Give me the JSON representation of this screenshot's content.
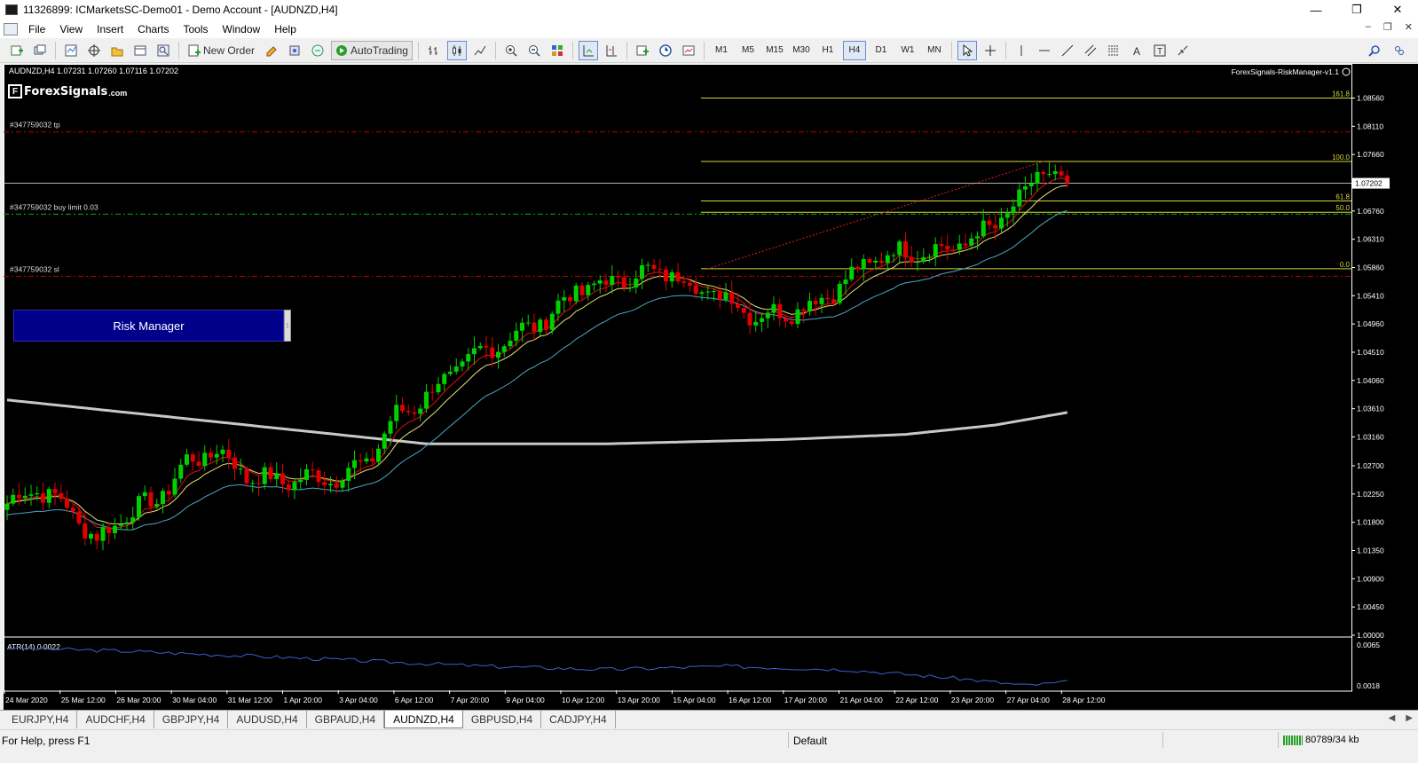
{
  "window": {
    "title": "11326899: ICMarketsSC-Demo01 - Demo Account - [AUDNZD,H4]",
    "minimize": "—",
    "restore": "❐",
    "close": "✕"
  },
  "menu": {
    "items": [
      "File",
      "View",
      "Insert",
      "Charts",
      "Tools",
      "Window",
      "Help"
    ],
    "mdi_minimize": "–",
    "mdi_restore": "❐",
    "mdi_close": "✕"
  },
  "toolbar": {
    "new_order": "New Order",
    "auto_trading": "AutoTrading",
    "timeframes": [
      "M1",
      "M5",
      "M15",
      "M30",
      "H1",
      "H4",
      "D1",
      "W1",
      "MN"
    ],
    "active_timeframe": "H4"
  },
  "chart": {
    "symbol_info": "AUDNZD,H4  1.07231 1.07260 1.07116 1.07202",
    "indicator_name": "ForexSignals-RiskManager-v1.1",
    "logo_text": "ForexSignals",
    "logo_suffix": ".com",
    "logo_mark": "F",
    "risk_manager_button": "Risk Manager",
    "risk_manager_grip": "⁞",
    "current_price_label": "1.07202",
    "order_labels": {
      "tp": "#347759032 tp",
      "buy_limit": "#347759032 buy limit 0.03",
      "sl": "#347759032 sl"
    },
    "fib_labels": [
      "161.8",
      "100.0",
      "61.8",
      "50.0",
      "0.0"
    ],
    "atr_label": "ATR(14) 0.0022",
    "atr_scale": [
      "0.0065",
      "0.0018"
    ],
    "colors": {
      "background": "#000000",
      "bull": "#00d000",
      "bear": "#e00000",
      "fib": "#d8d840",
      "tp_sl": "#c00000",
      "buy_limit": "#00b000",
      "ma_fast": "#e01010",
      "ma_mid": "#e8e070",
      "ma_slow": "#4aa8c8",
      "ma_long": "#c8c8c8",
      "atr": "#3a5fd0"
    }
  },
  "chart_data": {
    "type": "candlestick",
    "symbol": "AUDNZD",
    "timeframe": "H4",
    "ylim": [
      1.0,
      1.0885
    ],
    "price_ticks": [
      "1.08560",
      "1.08110",
      "1.07660",
      "1.07202",
      "1.06760",
      "1.06310",
      "1.05860",
      "1.05410",
      "1.04960",
      "1.04510",
      "1.04060",
      "1.03610",
      "1.03160",
      "1.02700",
      "1.02250",
      "1.01800",
      "1.01350",
      "1.00900",
      "1.00450",
      "1.00000"
    ],
    "time_labels": [
      "24 Mar 2020",
      "25 Mar 12:00",
      "26 Mar 20:00",
      "30 Mar 04:00",
      "31 Mar 12:00",
      "1 Apr 20:00",
      "3 Apr 04:00",
      "6 Apr 12:00",
      "7 Apr 20:00",
      "9 Apr 04:00",
      "10 Apr 12:00",
      "13 Apr 20:00",
      "15 Apr 04:00",
      "16 Apr 12:00",
      "17 Apr 20:00",
      "21 Apr 04:00",
      "22 Apr 12:00",
      "23 Apr 20:00",
      "27 Apr 04:00",
      "28 Apr 12:00"
    ],
    "current_price": 1.07202,
    "levels": {
      "tp": 1.0802,
      "buy_limit": 1.0671,
      "sl": 1.0572,
      "fib_161_8": 1.0856,
      "fib_100": 1.0755,
      "fib_61_8": 1.0692,
      "fib_50": 1.0674,
      "fib_0": 1.0584
    },
    "close_anchors": [
      [
        0,
        1.021
      ],
      [
        5,
        1.0235
      ],
      [
        10,
        1.0205
      ],
      [
        15,
        1.015
      ],
      [
        20,
        1.0195
      ],
      [
        25,
        1.0215
      ],
      [
        30,
        1.0275
      ],
      [
        35,
        1.0295
      ],
      [
        40,
        1.0255
      ],
      [
        45,
        1.0245
      ],
      [
        50,
        1.025
      ],
      [
        55,
        1.0252
      ],
      [
        60,
        1.0275
      ],
      [
        65,
        1.035
      ],
      [
        70,
        1.038
      ],
      [
        75,
        1.0425
      ],
      [
        80,
        1.0455
      ],
      [
        85,
        1.048
      ],
      [
        90,
        1.0505
      ],
      [
        95,
        1.055
      ],
      [
        100,
        1.056
      ],
      [
        105,
        1.0575
      ],
      [
        110,
        1.058
      ],
      [
        115,
        1.0555
      ],
      [
        120,
        1.0538
      ],
      [
        125,
        1.0508
      ],
      [
        130,
        1.0515
      ],
      [
        135,
        1.053
      ],
      [
        140,
        1.0565
      ],
      [
        145,
        1.0602
      ],
      [
        150,
        1.0612
      ],
      [
        155,
        1.0612
      ],
      [
        160,
        1.0625
      ],
      [
        165,
        1.0655
      ],
      [
        170,
        1.0698
      ],
      [
        172,
        1.0745
      ],
      [
        175,
        1.0725
      ],
      [
        177,
        1.07202
      ]
    ],
    "ma_long_anchors": [
      [
        0,
        1.0375
      ],
      [
        40,
        1.0335
      ],
      [
        70,
        1.0305
      ],
      [
        100,
        1.0305
      ],
      [
        130,
        1.0312
      ],
      [
        150,
        1.032
      ],
      [
        165,
        1.0335
      ],
      [
        177,
        1.0355
      ]
    ],
    "atr_anchors": [
      [
        0,
        0.0065
      ],
      [
        20,
        0.0061
      ],
      [
        50,
        0.0052
      ],
      [
        80,
        0.0042
      ],
      [
        100,
        0.0038
      ],
      [
        120,
        0.0042
      ],
      [
        140,
        0.0038
      ],
      [
        150,
        0.0032
      ],
      [
        160,
        0.0026
      ],
      [
        170,
        0.0018
      ],
      [
        177,
        0.0022
      ]
    ],
    "atr_ylim": [
      0.0012,
      0.0072
    ]
  },
  "tabs": [
    "EURJPY,H4",
    "AUDCHF,H4",
    "GBPJPY,H4",
    "AUDUSD,H4",
    "GBPAUD,H4",
    "AUDNZD,H4",
    "GBPUSD,H4",
    "CADJPY,H4"
  ],
  "active_tab": "AUDNZD,H4",
  "status": {
    "help": "For Help, press F1",
    "profile": "Default",
    "connection": "80789/34 kb"
  }
}
